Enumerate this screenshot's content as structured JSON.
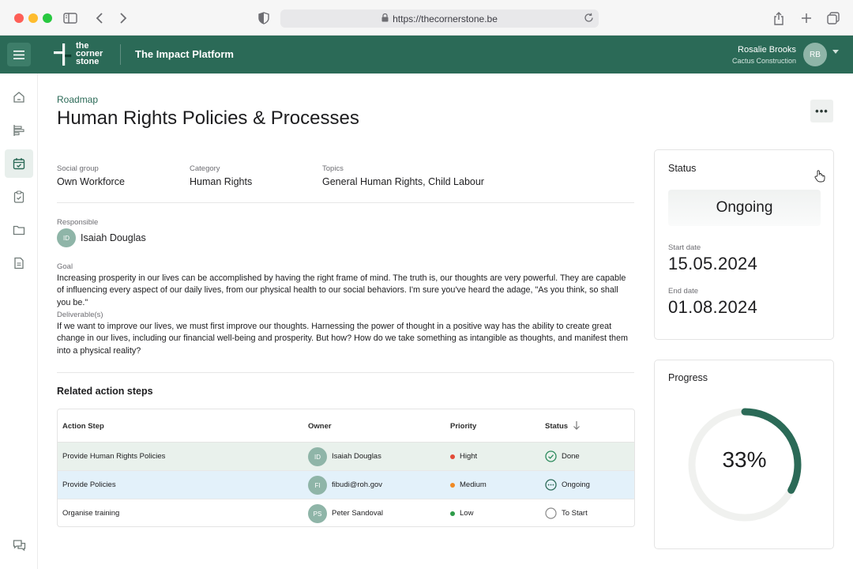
{
  "browser": {
    "url": "https://thecornerstone.be"
  },
  "header": {
    "logo_lines": [
      "the",
      "corner",
      "stone"
    ],
    "platform_title": "The Impact Platform",
    "user_name": "Rosalie Brooks",
    "user_company": "Cactus Construction",
    "user_initials": "RB",
    "brand_color": "#2b6a57"
  },
  "sidebar": {
    "items": [
      {
        "icon": "home-icon",
        "active": false
      },
      {
        "icon": "roadmap-icon",
        "active": false
      },
      {
        "icon": "calendar-check-icon",
        "active": true
      },
      {
        "icon": "clipboard-check-icon",
        "active": false
      },
      {
        "icon": "folder-icon",
        "active": false
      },
      {
        "icon": "document-icon",
        "active": false
      },
      {
        "icon": "chat-icon",
        "active": false
      }
    ]
  },
  "page": {
    "breadcrumb": "Roadmap",
    "title": "Human Rights Policies & Processes",
    "more_label": "•••"
  },
  "details": {
    "social_group_label": "Social group",
    "social_group": "Own Workforce",
    "category_label": "Category",
    "category": "Human Rights",
    "topics_label": "Topics",
    "topics": "General Human Rights, Child Labour",
    "responsible_label": "Responsible",
    "responsible_initials": "ID",
    "responsible_name": "Isaiah Douglas",
    "goal_label": "Goal",
    "goal_text": "Increasing prosperity in our lives can be accomplished by having the right frame of mind. The truth is, our thoughts are very powerful. They are capable of influencing every aspect of our daily lives, from our physical health to our social behaviors. I'm sure you've heard the adage, \"As you think, so shall you be.\"",
    "deliverables_label": "Deliverable(s)",
    "deliverables_text": " If we want to improve our lives, we must first improve our thoughts. Harnessing the power of thought in a positive way has the ability to create great change in our lives, including our financial well-being and prosperity. But how? How do we take something as intangible as thoughts, and manifest them into a physical reality?"
  },
  "action_steps": {
    "title": "Related action steps",
    "headers": {
      "step": "Action Step",
      "owner": "Owner",
      "priority": "Priority",
      "status": "Status"
    },
    "rows": [
      {
        "step": "Provide Human Rights Policies",
        "owner_initials": "ID",
        "owner": "Isaiah Douglas",
        "priority": "Hight",
        "priority_color": "#e24a36",
        "status": "Done",
        "state": "done"
      },
      {
        "step": "Provide Policies",
        "owner_initials": "FI",
        "owner": "fibudi@roh.gov",
        "priority": "Medium",
        "priority_color": "#f08a24",
        "status": "Ongoing",
        "state": "ongoing"
      },
      {
        "step": "Organise training",
        "owner_initials": "PS",
        "owner": "Peter Sandoval",
        "priority": "Low",
        "priority_color": "#2e9c4a",
        "status": "To Start",
        "state": "todo"
      }
    ]
  },
  "status_card": {
    "title": "Status",
    "status": "Ongoing",
    "start_label": "Start date",
    "start_date": "15.05.2024",
    "end_label": "End date",
    "end_date": "01.08.2024"
  },
  "progress_card": {
    "title": "Progress",
    "value_text": "33%",
    "value": 0.33,
    "ring_color": "#2b6a57",
    "track_color": "#f0f1ef"
  }
}
